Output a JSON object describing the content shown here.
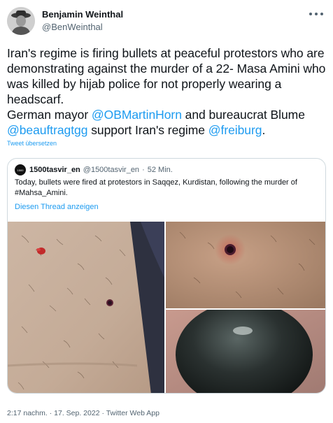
{
  "author": {
    "display_name": "Benjamin Weinthal",
    "handle": "@BenWeinthal"
  },
  "tweet": {
    "line1": "Iran's regime is firing bullets at peaceful protestors who are demonstrating against the murder of a 22- Masa Amini who was killed by hijab police for not properly wearing a headscarf.",
    "line2_prefix": "German mayor ",
    "mention1": "@OBMartinHorn",
    "line2_middle": " and bureaucrat Blume",
    "mention2": "@beauftragtgg",
    "line3_middle": " support Iran's regime ",
    "mention3": "@freiburg",
    "line3_suffix": ".",
    "translate_label": "Tweet übersetzen"
  },
  "quoted_tweet": {
    "avatar_text": "1500",
    "display_name": "1500tasvir_en",
    "handle": "@1500tasvir_en",
    "separator": "·",
    "time": "52 Min.",
    "text": "Today, bullets were fired at protestors in Saqqez, Kurdistan, following the murder of #Mahsa_Amini.",
    "thread_link": "Diesen Thread anzeigen"
  },
  "footer": {
    "time": "2:17 nachm.",
    "dot1": " · ",
    "date": "17. Sep. 2022",
    "dot2": " · ",
    "app": "Twitter Web App"
  }
}
